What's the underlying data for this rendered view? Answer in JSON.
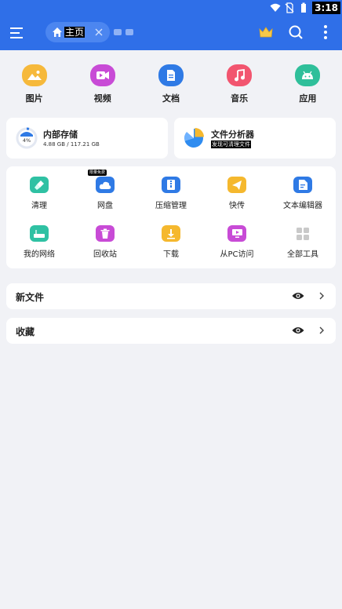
{
  "status_bar": {
    "time": "3:18",
    "icons": [
      "wifi-icon",
      "no-sim-icon",
      "battery-icon"
    ]
  },
  "app_bar": {
    "tab_label": "主页",
    "icons": [
      "menu-icon",
      "home-icon",
      "close-icon",
      "crown-icon",
      "search-icon",
      "more-vert-icon"
    ]
  },
  "categories": [
    {
      "label": "图片",
      "icon": "image-icon",
      "color": "#f6b93b"
    },
    {
      "label": "视频",
      "icon": "video-icon",
      "color": "#c84bd6"
    },
    {
      "label": "文档",
      "icon": "document-icon",
      "color": "#2f7ae5"
    },
    {
      "label": "音乐",
      "icon": "music-icon",
      "color": "#f2556f"
    },
    {
      "label": "应用",
      "icon": "android-icon",
      "color": "#2fbf9a"
    }
  ],
  "storage": {
    "title": "内部存储",
    "percent": "4%",
    "usage": "4.88 GB / 117.21 GB",
    "used_fraction": 0.04
  },
  "analyzer": {
    "title": "文件分析器",
    "subtitle": "发现可清理文件"
  },
  "tools": [
    {
      "label": "清理",
      "icon": "broom-icon",
      "color": "#2fc1a3"
    },
    {
      "label": "网盘",
      "icon": "cloud-icon",
      "color": "#2f7ae5",
      "badge": "限量免费"
    },
    {
      "label": "压缩管理",
      "icon": "archive-icon",
      "color": "#2f7ae5"
    },
    {
      "label": "快传",
      "icon": "send-icon",
      "color": "#f5b82e"
    },
    {
      "label": "文本编辑器",
      "icon": "text-editor-icon",
      "color": "#2f7ae5"
    },
    {
      "label": "我的网络",
      "icon": "router-icon",
      "color": "#2fc1a3"
    },
    {
      "label": "回收站",
      "icon": "trash-icon",
      "color": "#c84bd6"
    },
    {
      "label": "下载",
      "icon": "download-icon",
      "color": "#f5b82e"
    },
    {
      "label": "从PC访问",
      "icon": "pc-icon",
      "color": "#c84bd6"
    },
    {
      "label": "全部工具",
      "icon": "grid-icon",
      "color": "#bdbdbd"
    }
  ],
  "sections": [
    {
      "title": "新文件"
    },
    {
      "title": "收藏"
    }
  ],
  "colors": {
    "primary": "#2f6fe8",
    "background": "#f1f2f6"
  }
}
